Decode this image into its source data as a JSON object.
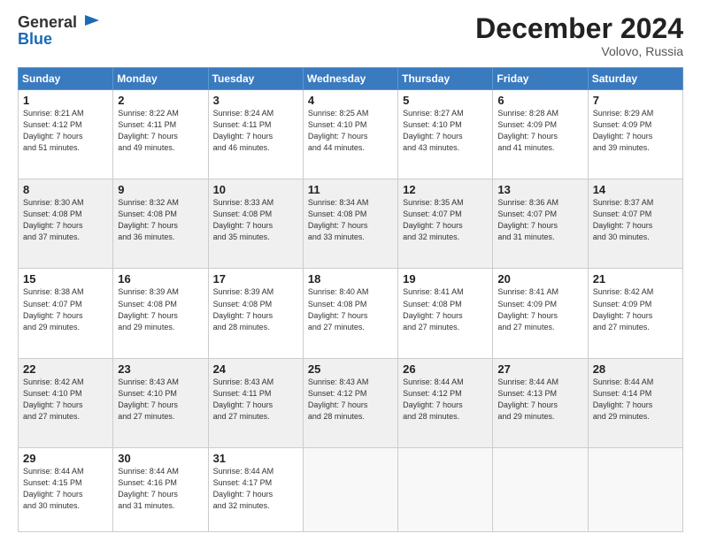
{
  "logo": {
    "general": "General",
    "blue": "Blue"
  },
  "header": {
    "month": "December 2024",
    "location": "Volovo, Russia"
  },
  "weekdays": [
    "Sunday",
    "Monday",
    "Tuesday",
    "Wednesday",
    "Thursday",
    "Friday",
    "Saturday"
  ],
  "weeks": [
    [
      {
        "day": "1",
        "info": "Sunrise: 8:21 AM\nSunset: 4:12 PM\nDaylight: 7 hours\nand 51 minutes."
      },
      {
        "day": "2",
        "info": "Sunrise: 8:22 AM\nSunset: 4:11 PM\nDaylight: 7 hours\nand 49 minutes."
      },
      {
        "day": "3",
        "info": "Sunrise: 8:24 AM\nSunset: 4:11 PM\nDaylight: 7 hours\nand 46 minutes."
      },
      {
        "day": "4",
        "info": "Sunrise: 8:25 AM\nSunset: 4:10 PM\nDaylight: 7 hours\nand 44 minutes."
      },
      {
        "day": "5",
        "info": "Sunrise: 8:27 AM\nSunset: 4:10 PM\nDaylight: 7 hours\nand 43 minutes."
      },
      {
        "day": "6",
        "info": "Sunrise: 8:28 AM\nSunset: 4:09 PM\nDaylight: 7 hours\nand 41 minutes."
      },
      {
        "day": "7",
        "info": "Sunrise: 8:29 AM\nSunset: 4:09 PM\nDaylight: 7 hours\nand 39 minutes."
      }
    ],
    [
      {
        "day": "8",
        "info": "Sunrise: 8:30 AM\nSunset: 4:08 PM\nDaylight: 7 hours\nand 37 minutes."
      },
      {
        "day": "9",
        "info": "Sunrise: 8:32 AM\nSunset: 4:08 PM\nDaylight: 7 hours\nand 36 minutes."
      },
      {
        "day": "10",
        "info": "Sunrise: 8:33 AM\nSunset: 4:08 PM\nDaylight: 7 hours\nand 35 minutes."
      },
      {
        "day": "11",
        "info": "Sunrise: 8:34 AM\nSunset: 4:08 PM\nDaylight: 7 hours\nand 33 minutes."
      },
      {
        "day": "12",
        "info": "Sunrise: 8:35 AM\nSunset: 4:07 PM\nDaylight: 7 hours\nand 32 minutes."
      },
      {
        "day": "13",
        "info": "Sunrise: 8:36 AM\nSunset: 4:07 PM\nDaylight: 7 hours\nand 31 minutes."
      },
      {
        "day": "14",
        "info": "Sunrise: 8:37 AM\nSunset: 4:07 PM\nDaylight: 7 hours\nand 30 minutes."
      }
    ],
    [
      {
        "day": "15",
        "info": "Sunrise: 8:38 AM\nSunset: 4:07 PM\nDaylight: 7 hours\nand 29 minutes."
      },
      {
        "day": "16",
        "info": "Sunrise: 8:39 AM\nSunset: 4:08 PM\nDaylight: 7 hours\nand 29 minutes."
      },
      {
        "day": "17",
        "info": "Sunrise: 8:39 AM\nSunset: 4:08 PM\nDaylight: 7 hours\nand 28 minutes."
      },
      {
        "day": "18",
        "info": "Sunrise: 8:40 AM\nSunset: 4:08 PM\nDaylight: 7 hours\nand 27 minutes."
      },
      {
        "day": "19",
        "info": "Sunrise: 8:41 AM\nSunset: 4:08 PM\nDaylight: 7 hours\nand 27 minutes."
      },
      {
        "day": "20",
        "info": "Sunrise: 8:41 AM\nSunset: 4:09 PM\nDaylight: 7 hours\nand 27 minutes."
      },
      {
        "day": "21",
        "info": "Sunrise: 8:42 AM\nSunset: 4:09 PM\nDaylight: 7 hours\nand 27 minutes."
      }
    ],
    [
      {
        "day": "22",
        "info": "Sunrise: 8:42 AM\nSunset: 4:10 PM\nDaylight: 7 hours\nand 27 minutes."
      },
      {
        "day": "23",
        "info": "Sunrise: 8:43 AM\nSunset: 4:10 PM\nDaylight: 7 hours\nand 27 minutes."
      },
      {
        "day": "24",
        "info": "Sunrise: 8:43 AM\nSunset: 4:11 PM\nDaylight: 7 hours\nand 27 minutes."
      },
      {
        "day": "25",
        "info": "Sunrise: 8:43 AM\nSunset: 4:12 PM\nDaylight: 7 hours\nand 28 minutes."
      },
      {
        "day": "26",
        "info": "Sunrise: 8:44 AM\nSunset: 4:12 PM\nDaylight: 7 hours\nand 28 minutes."
      },
      {
        "day": "27",
        "info": "Sunrise: 8:44 AM\nSunset: 4:13 PM\nDaylight: 7 hours\nand 29 minutes."
      },
      {
        "day": "28",
        "info": "Sunrise: 8:44 AM\nSunset: 4:14 PM\nDaylight: 7 hours\nand 29 minutes."
      }
    ],
    [
      {
        "day": "29",
        "info": "Sunrise: 8:44 AM\nSunset: 4:15 PM\nDaylight: 7 hours\nand 30 minutes."
      },
      {
        "day": "30",
        "info": "Sunrise: 8:44 AM\nSunset: 4:16 PM\nDaylight: 7 hours\nand 31 minutes."
      },
      {
        "day": "31",
        "info": "Sunrise: 8:44 AM\nSunset: 4:17 PM\nDaylight: 7 hours\nand 32 minutes."
      },
      {
        "day": "",
        "info": ""
      },
      {
        "day": "",
        "info": ""
      },
      {
        "day": "",
        "info": ""
      },
      {
        "day": "",
        "info": ""
      }
    ]
  ]
}
